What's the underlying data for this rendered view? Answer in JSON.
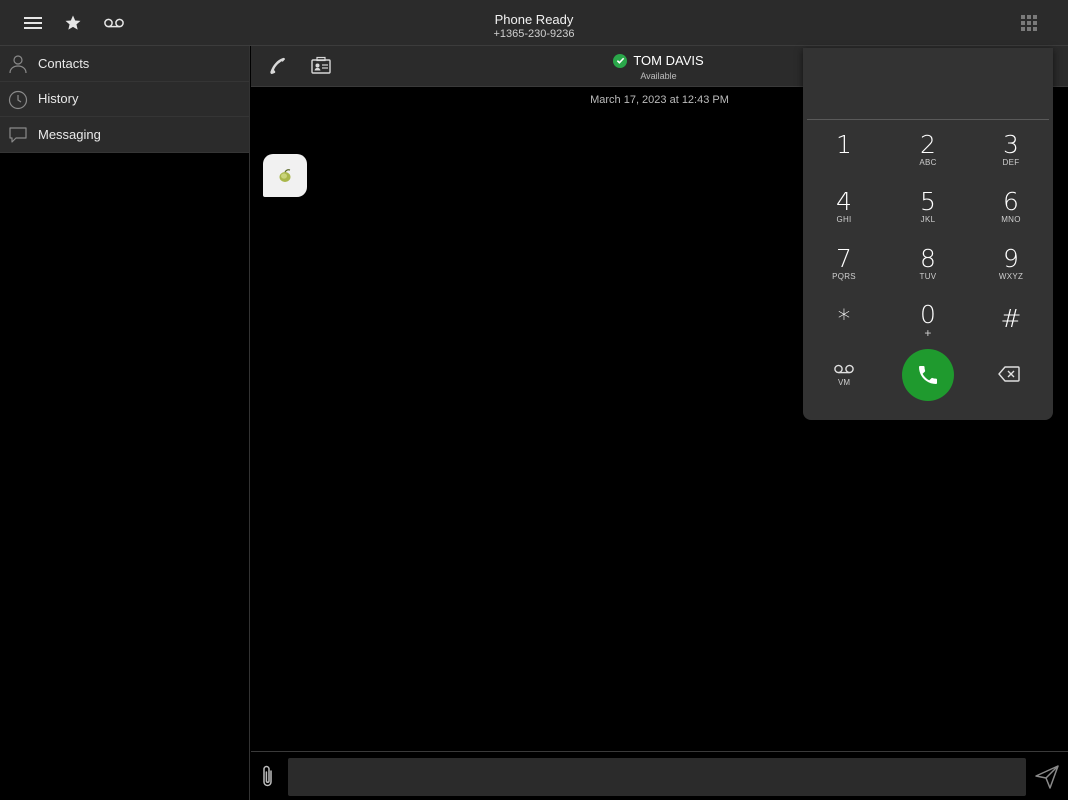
{
  "topbar": {
    "status_title": "Phone Ready",
    "status_number": "+1365-230-9236",
    "icons": [
      "menu-icon",
      "star-icon",
      "voicemail-icon",
      "dialpad-grid-icon"
    ]
  },
  "sidebar": {
    "items": [
      {
        "label": "Contacts",
        "icon": "person-icon"
      },
      {
        "label": "History",
        "icon": "clock-icon"
      },
      {
        "label": "Messaging",
        "icon": "chat-bubble-icon"
      }
    ]
  },
  "conversation": {
    "contact_name": "TOM DAVIS",
    "contact_status": "Available",
    "timestamp": "March 17, 2023 at 12:43 PM",
    "message_content": "olive-emoji"
  },
  "composer": {
    "input_value": "",
    "placeholder": ""
  },
  "dialpad": {
    "display_value": "",
    "keys": [
      {
        "digit": "1",
        "letters": ""
      },
      {
        "digit": "2",
        "letters": "ABC"
      },
      {
        "digit": "3",
        "letters": "DEF"
      },
      {
        "digit": "4",
        "letters": "GHI"
      },
      {
        "digit": "5",
        "letters": "JKL"
      },
      {
        "digit": "6",
        "letters": "MNO"
      },
      {
        "digit": "7",
        "letters": "PQRS"
      },
      {
        "digit": "8",
        "letters": "TUV"
      },
      {
        "digit": "9",
        "letters": "WXYZ"
      },
      {
        "digit": "*",
        "letters": ""
      },
      {
        "digit": "0",
        "letters": "+"
      },
      {
        "digit": "#",
        "letters": ""
      }
    ],
    "vm_label": "VM"
  },
  "colors": {
    "bar_background": "#2b2b2b",
    "dialpad_background": "#333333",
    "call_green": "#1f9a2e",
    "presence_green": "#2aa74a"
  }
}
